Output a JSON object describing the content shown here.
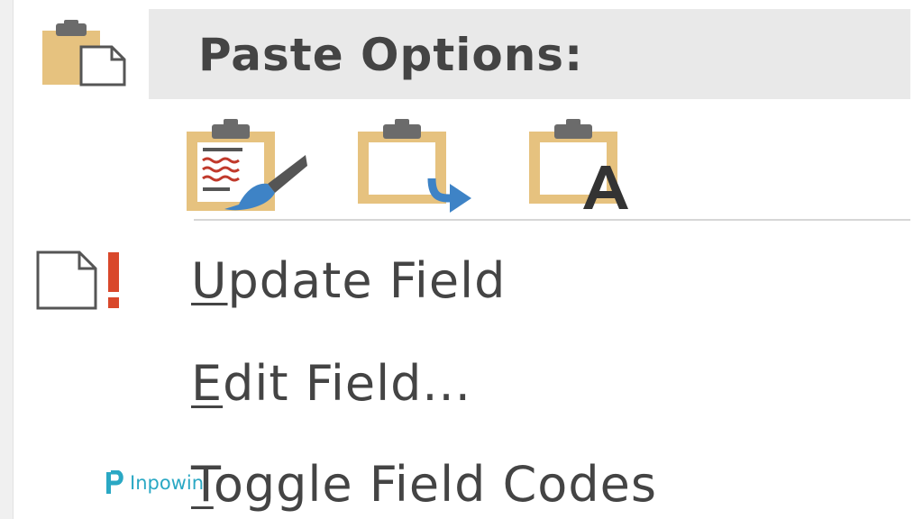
{
  "paste_options": {
    "header_label": "Paste Options:",
    "icons": {
      "header": "clipboard-paste-icon",
      "keep_source_formatting": "clipboard-paintbrush-icon",
      "merge_formatting": "clipboard-arrow-icon",
      "keep_text_only": "clipboard-letter-a-icon"
    }
  },
  "menu_items": [
    {
      "mnemonic": "U",
      "rest": "pdate Field",
      "icon": "document-exclamation-icon"
    },
    {
      "mnemonic": "E",
      "rest": "dit Field...",
      "icon": ""
    },
    {
      "mnemonic": "T",
      "rest": "oggle Field Codes",
      "icon": ""
    }
  ],
  "watermark": {
    "text": "Inpowin",
    "icon": "inpowin-logo-icon"
  },
  "colors": {
    "clipboard_tan": "#e6c27f",
    "clip_gray": "#6b6b6b",
    "arrow_blue": "#3e83c6",
    "exclaim_red": "#d9482b",
    "header_bg": "#e9e9e9",
    "text": "#444444",
    "watermark": "#2aa8c4"
  }
}
